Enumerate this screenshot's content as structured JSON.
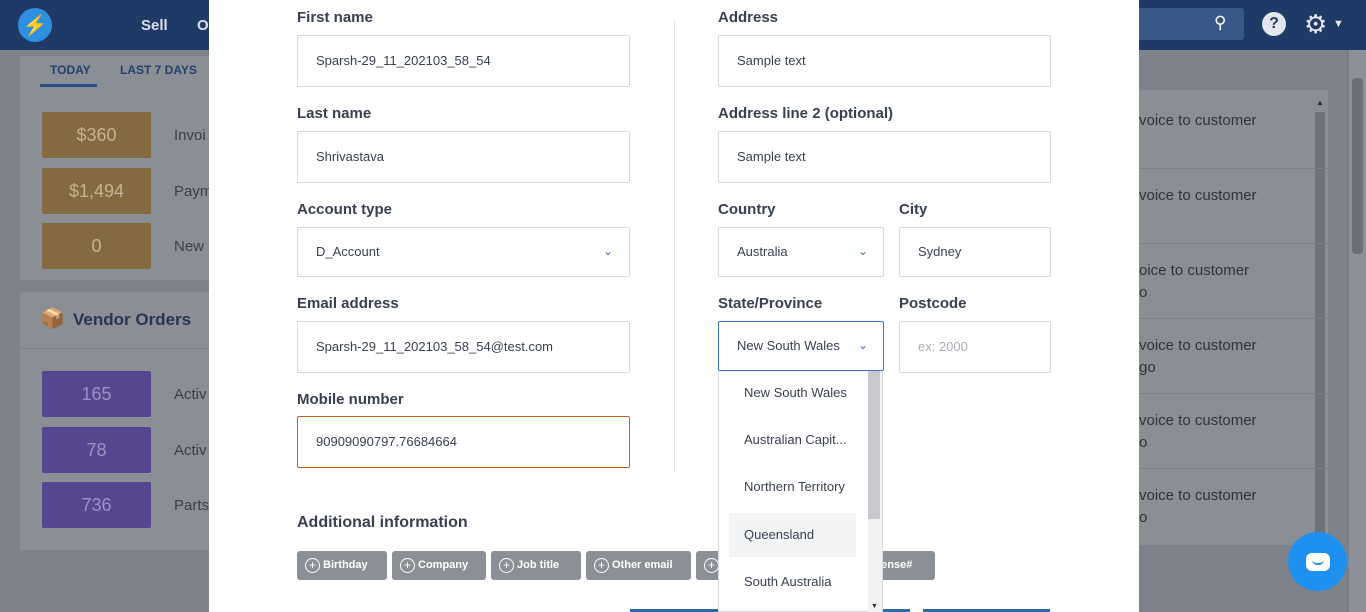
{
  "background": {
    "nav": {
      "sell": "Sell",
      "partial": "O"
    },
    "tabs": {
      "today": "TODAY",
      "last7": "LAST 7 DAYS"
    },
    "stats_top": [
      {
        "value": "$360",
        "label": "Invoi"
      },
      {
        "value": "$1,494",
        "label": "Paym"
      },
      {
        "value": "0",
        "label": "New"
      }
    ],
    "vendor_orders": {
      "title": "Vendor Orders",
      "items": [
        {
          "value": "165",
          "label": "Activ"
        },
        {
          "value": "78",
          "label": "Activ"
        },
        {
          "value": "736",
          "label": "Parts"
        }
      ]
    },
    "right_list": [
      {
        "line1": "voice to customer",
        "line2": ""
      },
      {
        "line1": "voice to customer",
        "line2": ""
      },
      {
        "line1": "oice to customer",
        "line2": "o"
      },
      {
        "line1": "voice to customer",
        "line2": "go"
      },
      {
        "line1": "voice to customer",
        "line2": "o"
      },
      {
        "line1": "voice to customer",
        "line2": "o"
      }
    ],
    "colors": {
      "topbar": "#1f3a66",
      "chat": "#1e90f0"
    }
  },
  "form": {
    "first_name": {
      "label": "First name",
      "value": "Sparsh-29_11_202103_58_54"
    },
    "last_name": {
      "label": "Last name",
      "value": "Shrivastava"
    },
    "account_type": {
      "label": "Account type",
      "value": "D_Account"
    },
    "email": {
      "label": "Email address",
      "value": "Sparsh-29_11_202103_58_54@test.com"
    },
    "mobile": {
      "label": "Mobile number",
      "value": "90909090797.76684664"
    },
    "address": {
      "label": "Address",
      "value": "Sample text"
    },
    "address2": {
      "label": "Address line 2 (optional)",
      "value": "Sample text"
    },
    "country": {
      "label": "Country",
      "value": "Australia"
    },
    "city": {
      "label": "City",
      "value": "Sydney"
    },
    "state": {
      "label": "State/Province",
      "value": "New South Wales"
    },
    "postcode": {
      "label": "Postcode",
      "placeholder": "ex: 2000"
    },
    "state_options": [
      "New South Wales",
      "Australian Capit...",
      "Northern Territory",
      "Queensland",
      "South Australia"
    ],
    "additional": {
      "title": "Additional information",
      "chips": [
        "Birthday",
        "Company",
        "Job title",
        "Other email",
        "",
        "icense#"
      ]
    }
  }
}
